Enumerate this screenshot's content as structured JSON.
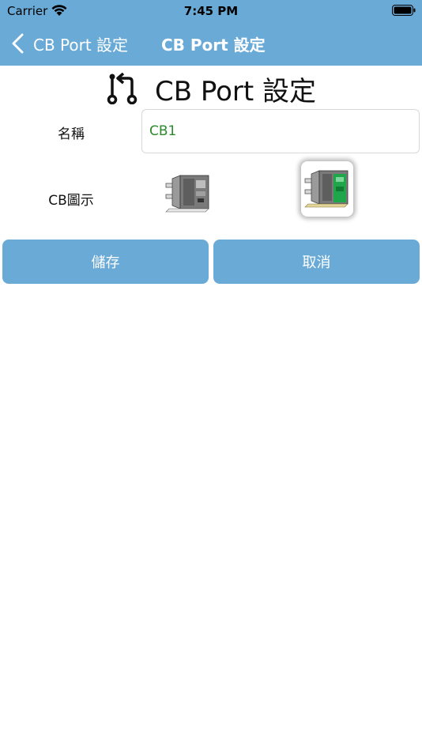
{
  "status_bar": {
    "carrier": "Carrier",
    "time": "7:45 PM"
  },
  "nav": {
    "back_label": "CB Port 設定",
    "title": "CB Port 設定"
  },
  "page": {
    "title": "CB Port 設定",
    "title_icon": "pull-request-icon"
  },
  "form": {
    "name_label": "名稱",
    "name_value": "CB1",
    "icon_label": "CB圖示",
    "icon_options": [
      {
        "icon": "circuit-breaker-gray-icon",
        "selected": false
      },
      {
        "icon": "circuit-breaker-green-icon",
        "selected": true
      }
    ]
  },
  "actions": {
    "save_label": "儲存",
    "cancel_label": "取消"
  },
  "colors": {
    "accent": "#6aaad6",
    "value_text": "#2b8a2b"
  }
}
